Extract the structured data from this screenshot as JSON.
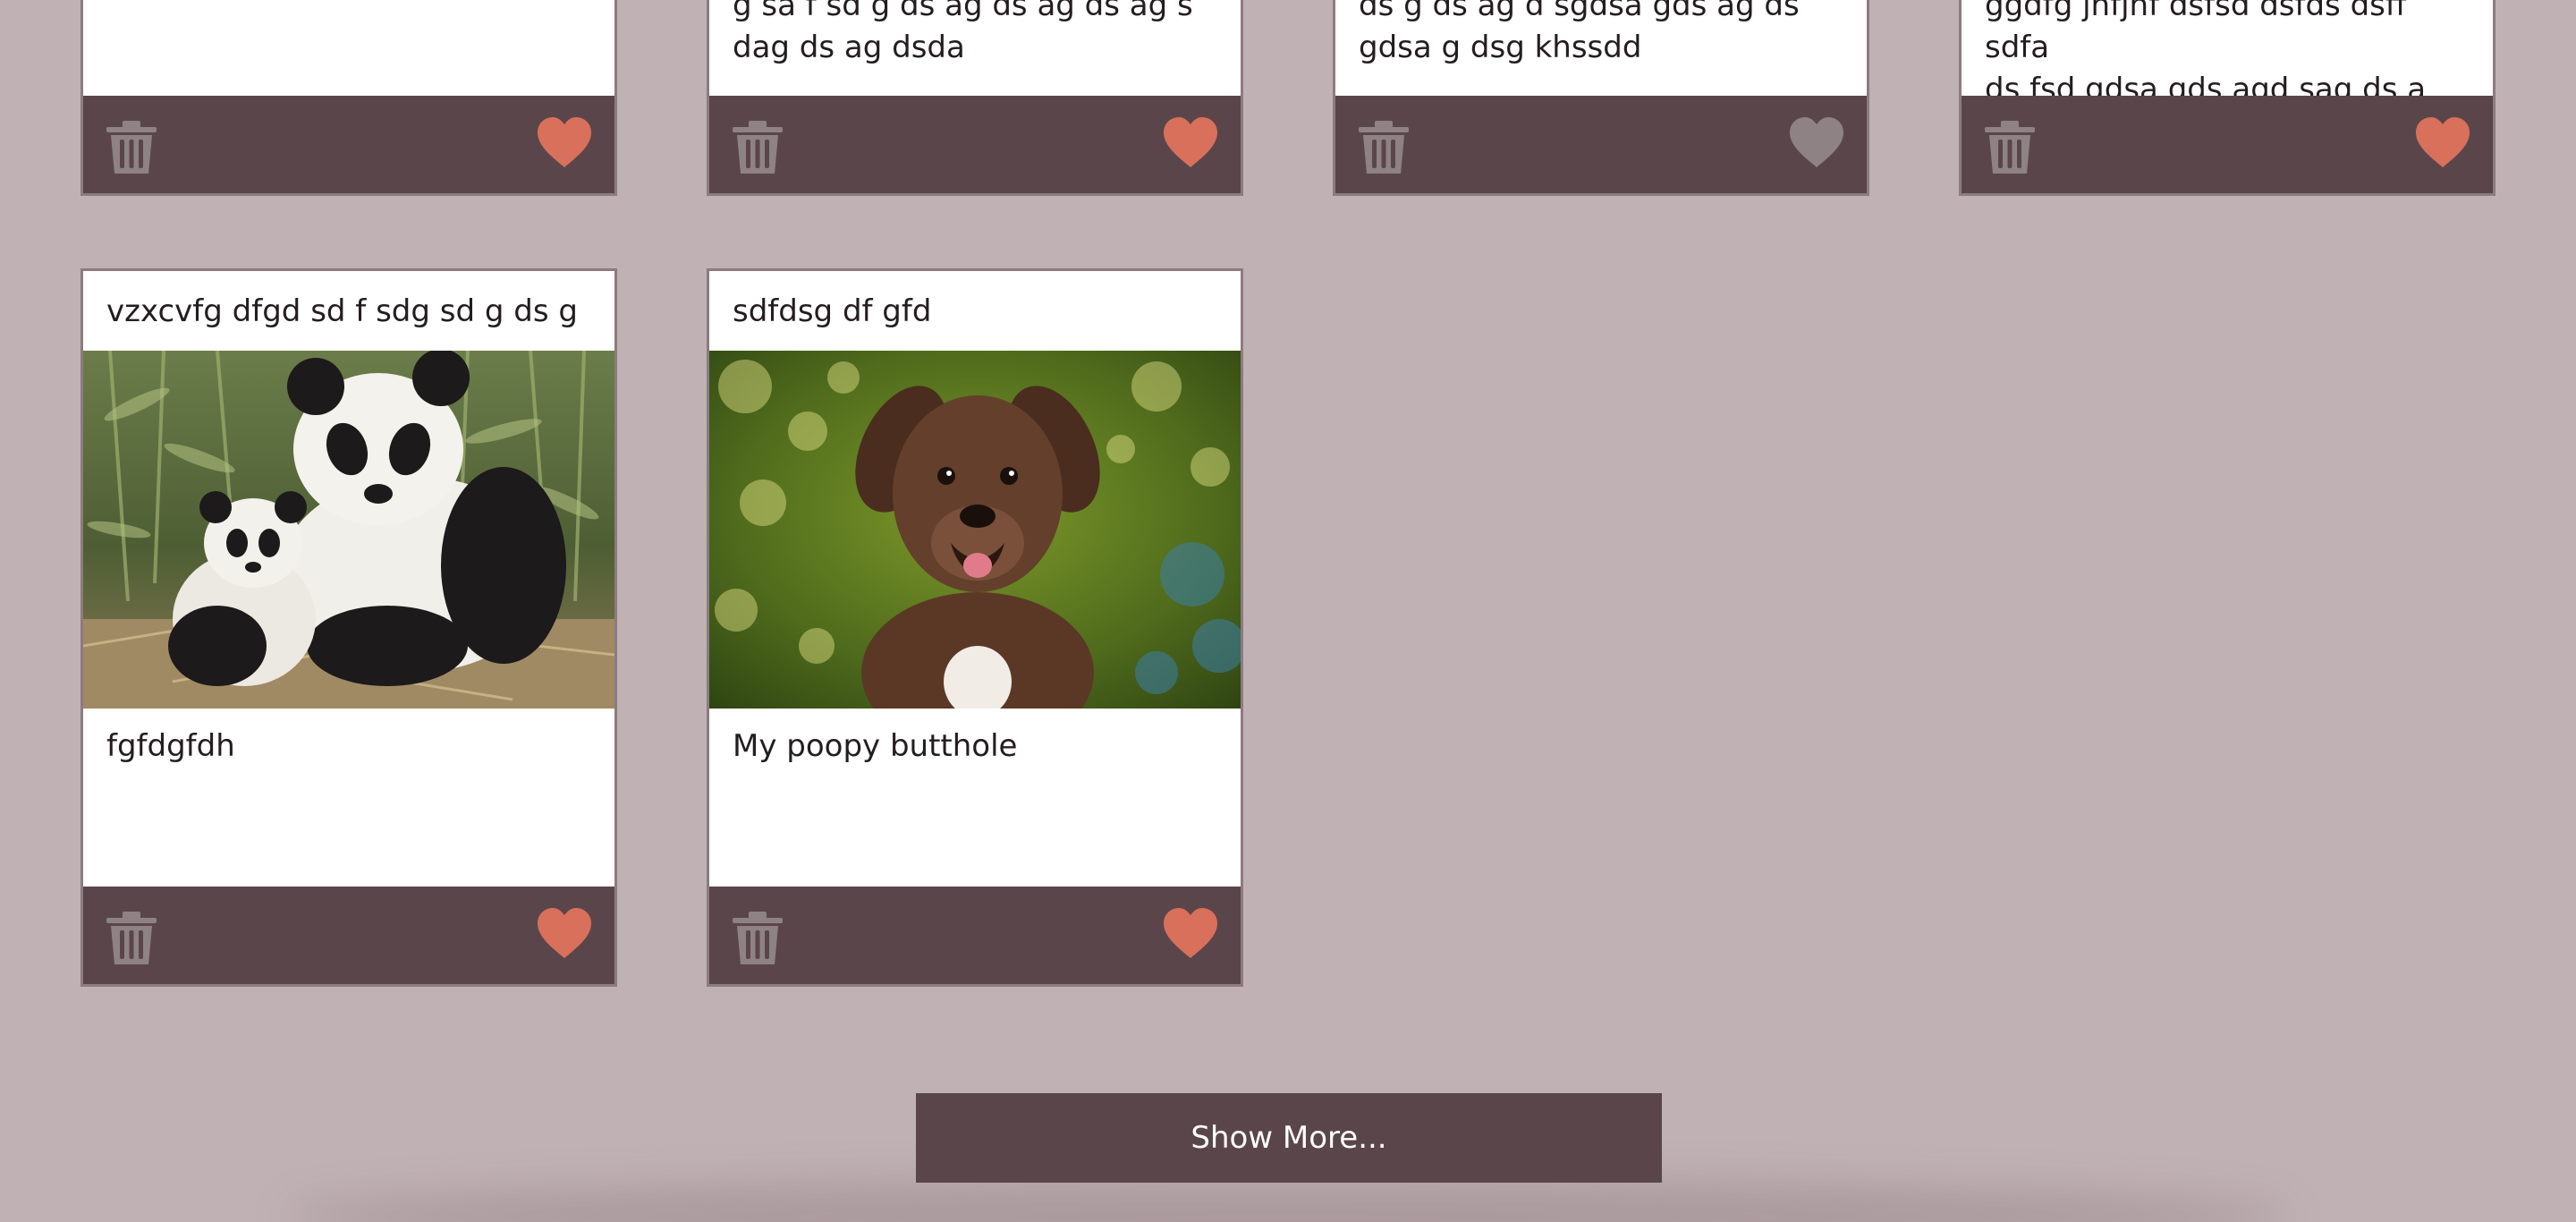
{
  "cards_top": [
    {
      "lines": [
        "g sa f sd g ds ag ds ag ds ag s",
        "dag ds ag dsda"
      ],
      "liked": true
    },
    {
      "lines": [
        "ds g ds ag d sgdsa gds ag ds",
        "gdsa g dsg khssdd"
      ],
      "liked": false
    },
    {
      "lines": [
        "ggdfg jnfjnf dsfsd dsfds dsff sdfa",
        "ds fsd gdsa gds agd sag ds a"
      ],
      "liked": true
    }
  ],
  "cards_bottom": [
    {
      "title": "vzxcvfg dfgd sd f sdg sd g ds g",
      "image": "panda-photo",
      "caption": "fgfdgfdh",
      "liked": true
    },
    {
      "title": "sdfdsg df gfd",
      "image": "puppy-photo",
      "caption": "My poopy butthole",
      "liked": true
    }
  ],
  "icons": {
    "delete": "trash-icon",
    "like": "heart-icon"
  },
  "colors": {
    "background": "#bfb1b4",
    "card_footer": "#5a464a",
    "heart_liked": "#d9705c",
    "heart_unliked": "#8e8285",
    "trash": "#8e8285"
  },
  "show_more_label": "Show More..."
}
